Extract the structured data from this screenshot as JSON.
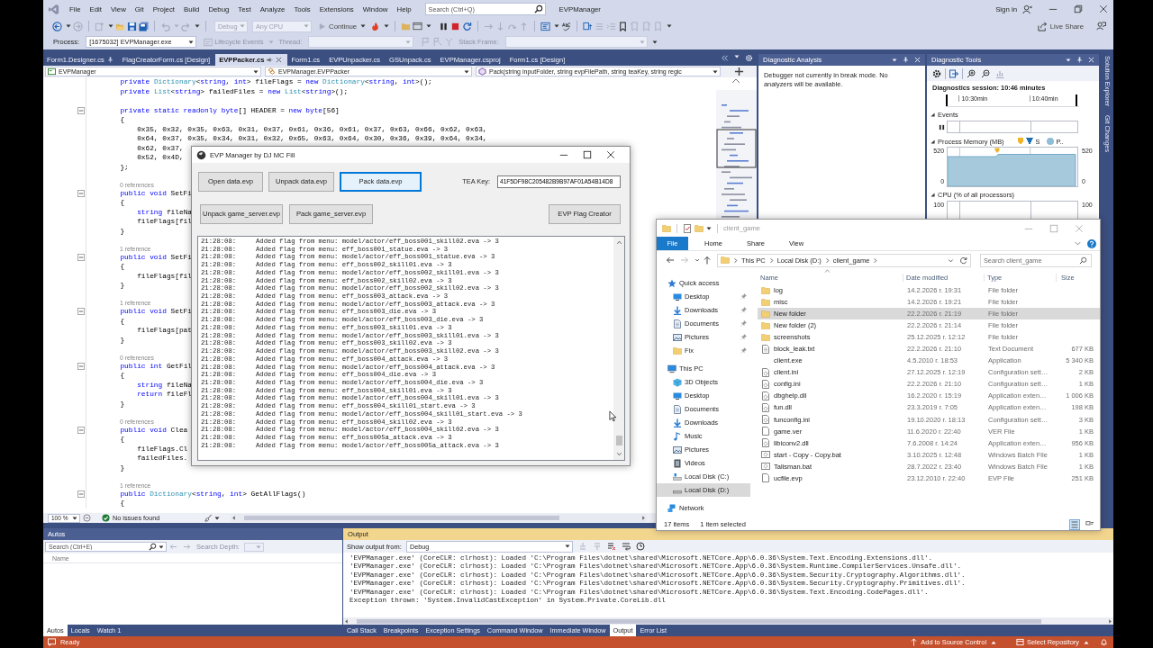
{
  "window": {
    "menu": [
      "File",
      "Edit",
      "View",
      "Git",
      "Project",
      "Build",
      "Debug",
      "Test",
      "Analyze",
      "Tools",
      "Extensions",
      "Window",
      "Help"
    ],
    "search": {
      "placeholder": "Search (Ctrl+Q)"
    },
    "title": "EVPManager",
    "sign_in": "Sign in"
  },
  "toolbar": {
    "configuration": {
      "value": "Debug",
      "disabled": true
    },
    "platform": {
      "value": "Any CPU",
      "disabled": true
    },
    "continue": "Continue",
    "live_share": "Live Share"
  },
  "debug_location": {
    "process_label": "Process:",
    "process": "[1675032] EVPManager.exe",
    "lifecycle_events": "Lifecycle Events",
    "thread_label": "Thread:",
    "stack_frame_label": "Stack Frame:"
  },
  "document_tabs": [
    {
      "label": "Form1.Designer.cs",
      "selected": false,
      "pinned": true
    },
    {
      "label": "FlagCreatorForm.cs [Design]",
      "selected": false,
      "pinned": false
    },
    {
      "label": "EVPPacker.cs",
      "selected": true,
      "pinned": false
    },
    {
      "label": "Form1.cs",
      "selected": false,
      "pinned": false
    },
    {
      "label": "EVPUnpacker.cs",
      "selected": false,
      "pinned": false
    },
    {
      "label": "GSUnpack.cs",
      "selected": false,
      "pinned": false
    },
    {
      "label": "EVPManager.csproj",
      "selected": false,
      "pinned": false
    },
    {
      "label": "Form1.cs [Design]",
      "selected": false,
      "pinned": false
    }
  ],
  "navigation_bar": {
    "project": "EVPManager",
    "type": "EVPManager.EVPPacker",
    "member": "Pack(string inputFolder, string evpFilePath, string teaKey, string regic"
  },
  "editor": {
    "lines": [
      {
        "kind": "code",
        "segments": [
          {
            "kind": "keyword",
            "text": "        private "
          },
          {
            "kind": "type",
            "text": "Dictionary"
          },
          {
            "kind": "plain",
            "text": "<"
          },
          {
            "kind": "keyword",
            "text": "string"
          },
          {
            "kind": "plain",
            "text": ", "
          },
          {
            "kind": "keyword",
            "text": "int"
          },
          {
            "kind": "plain",
            "text": "> fileFlags = "
          },
          {
            "kind": "keyword",
            "text": "new "
          },
          {
            "kind": "type",
            "text": "Dictionary"
          },
          {
            "kind": "plain",
            "text": "<"
          },
          {
            "kind": "keyword",
            "text": "string"
          },
          {
            "kind": "plain",
            "text": ", "
          },
          {
            "kind": "keyword",
            "text": "int"
          },
          {
            "kind": "plain",
            "text": ">();"
          }
        ]
      },
      {
        "kind": "code",
        "segments": [
          {
            "kind": "keyword",
            "text": "        private "
          },
          {
            "kind": "type",
            "text": "List"
          },
          {
            "kind": "plain",
            "text": "<"
          },
          {
            "kind": "keyword",
            "text": "string"
          },
          {
            "kind": "plain",
            "text": "> failedFiles = "
          },
          {
            "kind": "keyword",
            "text": "new "
          },
          {
            "kind": "type",
            "text": "List"
          },
          {
            "kind": "plain",
            "text": "<"
          },
          {
            "kind": "keyword",
            "text": "string"
          },
          {
            "kind": "plain",
            "text": ">();"
          }
        ]
      },
      {
        "kind": "blank"
      },
      {
        "kind": "member",
        "segments": [
          {
            "kind": "keyword",
            "text": "        private static readonly byte"
          },
          {
            "kind": "plain",
            "text": "[] HEADER = "
          },
          {
            "kind": "keyword",
            "text": "new byte"
          },
          {
            "kind": "plain",
            "text": "[56]"
          }
        ]
      },
      {
        "kind": "code",
        "segments": [
          {
            "kind": "plain",
            "text": "        {"
          }
        ]
      },
      {
        "kind": "code",
        "segments": [
          {
            "kind": "plain",
            "text": "            0x35, 0x32, 0x35, 0x63, 0x31, 0x37, 0x61, 0x36, 0x61, 0x37, 0x63, 0x66, 0x62, 0x63,"
          }
        ]
      },
      {
        "kind": "code",
        "segments": [
          {
            "kind": "plain",
            "text": "            0x64, 0x37, 0x35, 0x34, 0x31, 0x32, 0x65, 0x63, 0x64, 0x30, 0x36, 0x39, 0x64, 0x34,"
          }
        ]
      },
      {
        "kind": "code",
        "segments": [
          {
            "kind": "plain",
            "text": "            0x62, 0x37,"
          }
        ]
      },
      {
        "kind": "code",
        "segments": [
          {
            "kind": "plain",
            "text": "            0x52, 0x4D,"
          }
        ]
      },
      {
        "kind": "code",
        "segments": [
          {
            "kind": "plain",
            "text": "        };"
          }
        ]
      },
      {
        "kind": "blank"
      },
      {
        "kind": "lens",
        "text": "0 references"
      },
      {
        "kind": "member",
        "segments": [
          {
            "kind": "keyword",
            "text": "        public void"
          },
          {
            "kind": "plain",
            "text": " SetFi"
          }
        ]
      },
      {
        "kind": "code",
        "segments": [
          {
            "kind": "plain",
            "text": "        {"
          }
        ]
      },
      {
        "kind": "code",
        "segments": [
          {
            "kind": "keyword",
            "text": "            string"
          },
          {
            "kind": "plain",
            "text": " fileNa"
          }
        ]
      },
      {
        "kind": "code",
        "segments": [
          {
            "kind": "plain",
            "text": "            fileFlags[fil"
          }
        ]
      },
      {
        "kind": "code",
        "segments": [
          {
            "kind": "plain",
            "text": "        }"
          }
        ]
      },
      {
        "kind": "blank"
      },
      {
        "kind": "lens",
        "text": "1 reference"
      },
      {
        "kind": "member",
        "segments": [
          {
            "kind": "keyword",
            "text": "        public void"
          },
          {
            "kind": "plain",
            "text": " SetFi"
          }
        ]
      },
      {
        "kind": "code",
        "segments": [
          {
            "kind": "plain",
            "text": "        {"
          }
        ]
      },
      {
        "kind": "code",
        "segments": [
          {
            "kind": "plain",
            "text": "            fileFlags[fil"
          }
        ]
      },
      {
        "kind": "code",
        "segments": [
          {
            "kind": "plain",
            "text": "        }"
          }
        ]
      },
      {
        "kind": "blank"
      },
      {
        "kind": "lens",
        "text": "1 reference"
      },
      {
        "kind": "member",
        "segments": [
          {
            "kind": "keyword",
            "text": "        public void"
          },
          {
            "kind": "plain",
            "text": " SetFi"
          }
        ]
      },
      {
        "kind": "code",
        "segments": [
          {
            "kind": "plain",
            "text": "        {"
          }
        ]
      },
      {
        "kind": "code",
        "segments": [
          {
            "kind": "plain",
            "text": "            fileFlags[pat"
          }
        ]
      },
      {
        "kind": "code",
        "segments": [
          {
            "kind": "plain",
            "text": "        }"
          }
        ]
      },
      {
        "kind": "blank"
      },
      {
        "kind": "lens",
        "text": "0 references"
      },
      {
        "kind": "member",
        "segments": [
          {
            "kind": "keyword",
            "text": "        public int"
          },
          {
            "kind": "plain",
            "text": " GetFil"
          }
        ]
      },
      {
        "kind": "code",
        "segments": [
          {
            "kind": "plain",
            "text": "        {"
          }
        ]
      },
      {
        "kind": "code",
        "segments": [
          {
            "kind": "keyword",
            "text": "            string"
          },
          {
            "kind": "plain",
            "text": " fileNa"
          }
        ]
      },
      {
        "kind": "code",
        "segments": [
          {
            "kind": "keyword",
            "text": "            return"
          },
          {
            "kind": "plain",
            "text": " fileFl"
          }
        ]
      },
      {
        "kind": "code",
        "segments": [
          {
            "kind": "plain",
            "text": "        }"
          }
        ]
      },
      {
        "kind": "blank"
      },
      {
        "kind": "lens",
        "text": "0 references"
      },
      {
        "kind": "member",
        "segments": [
          {
            "kind": "keyword",
            "text": "        public void"
          },
          {
            "kind": "plain",
            "text": " Clea"
          }
        ]
      },
      {
        "kind": "code",
        "segments": [
          {
            "kind": "plain",
            "text": "        {"
          }
        ]
      },
      {
        "kind": "code",
        "segments": [
          {
            "kind": "plain",
            "text": "            fileFlags.Cl"
          }
        ]
      },
      {
        "kind": "code",
        "segments": [
          {
            "kind": "plain",
            "text": "            failedFiles."
          }
        ]
      },
      {
        "kind": "code",
        "segments": [
          {
            "kind": "plain",
            "text": "        }"
          }
        ]
      },
      {
        "kind": "blank"
      },
      {
        "kind": "lens",
        "text": "1 reference"
      },
      {
        "kind": "member",
        "segments": [
          {
            "kind": "keyword",
            "text": "        public "
          },
          {
            "kind": "type",
            "text": "Dictionary"
          },
          {
            "kind": "plain",
            "text": "<"
          },
          {
            "kind": "keyword",
            "text": "string"
          },
          {
            "kind": "plain",
            "text": ", "
          },
          {
            "kind": "keyword",
            "text": "int"
          },
          {
            "kind": "plain",
            "text": "> GetAllFlags()"
          }
        ]
      },
      {
        "kind": "code",
        "segments": [
          {
            "kind": "plain",
            "text": "        {"
          }
        ]
      }
    ],
    "zoom": "100 %",
    "issues": "No issues found"
  },
  "evp_manager": {
    "title": "EVP Manager by DJ MC Fill",
    "buttons_row_1": [
      {
        "label": "Open data.evp",
        "focused": false
      },
      {
        "label": "Unpack data.evp",
        "focused": false
      },
      {
        "label": "Pack data.evp",
        "focused": true
      }
    ],
    "tea_key": {
      "label": "TEA Key:",
      "value": "41F5DF98C205482B9B97AF01A54B14D8"
    },
    "buttons_row_2": [
      "Unpack game_server.evp",
      "Pack game_server.evp"
    ],
    "flag_creator": "EVP Flag Creator",
    "log": [
      {
        "time": "21:28:08:",
        "message": "Added flag from menu: model/actor/eff_boss001_skill02.eva -> 3"
      },
      {
        "time": "21:28:08:",
        "message": "Added flag from menu: eff_boss001_statue.eva -> 3"
      },
      {
        "time": "21:28:08:",
        "message": "Added flag from menu: model/actor/eff_boss001_statue.eva -> 3"
      },
      {
        "time": "21:28:08:",
        "message": "Added flag from menu: eff_boss002_skill01.eva -> 3"
      },
      {
        "time": "21:28:08:",
        "message": "Added flag from menu: model/actor/eff_boss002_skill01.eva -> 3"
      },
      {
        "time": "21:28:08:",
        "message": "Added flag from menu: eff_boss002_skill02.eva -> 3"
      },
      {
        "time": "21:28:08:",
        "message": "Added flag from menu: model/actor/eff_boss002_skill02.eva -> 3"
      },
      {
        "time": "21:28:08:",
        "message": "Added flag from menu: eff_boss003_attack.eva -> 3"
      },
      {
        "time": "21:28:08:",
        "message": "Added flag from menu: model/actor/eff_boss003_attack.eva -> 3"
      },
      {
        "time": "21:28:08:",
        "message": "Added flag from menu: eff_boss003_die.eva -> 3"
      },
      {
        "time": "21:28:08:",
        "message": "Added flag from menu: model/actor/eff_boss003_die.eva -> 3"
      },
      {
        "time": "21:28:08:",
        "message": "Added flag from menu: eff_boss003_skill01.eva -> 3"
      },
      {
        "time": "21:28:08:",
        "message": "Added flag from menu: model/actor/eff_boss003_skill01.eva -> 3"
      },
      {
        "time": "21:28:08:",
        "message": "Added flag from menu: eff_boss003_skill02.eva -> 3"
      },
      {
        "time": "21:28:08:",
        "message": "Added flag from menu: model/actor/eff_boss003_skill02.eva -> 3"
      },
      {
        "time": "21:28:08:",
        "message": "Added flag from menu: eff_boss004_attack.eva -> 3"
      },
      {
        "time": "21:28:08:",
        "message": "Added flag from menu: model/actor/eff_boss004_attack.eva -> 3"
      },
      {
        "time": "21:28:08:",
        "message": "Added flag from menu: eff_boss004_die.eva -> 3"
      },
      {
        "time": "21:28:08:",
        "message": "Added flag from menu: model/actor/eff_boss004_die.eva -> 3"
      },
      {
        "time": "21:28:08:",
        "message": "Added flag from menu: eff_boss004_skill01.eva -> 3"
      },
      {
        "time": "21:28:08:",
        "message": "Added flag from menu: model/actor/eff_boss004_skill01.eva -> 3"
      },
      {
        "time": "21:28:08:",
        "message": "Added flag from menu: eff_boss004_skill01_start.eva -> 3"
      },
      {
        "time": "21:28:08:",
        "message": "Added flag from menu: model/actor/eff_boss004_skill01_start.eva -> 3"
      },
      {
        "time": "21:28:08:",
        "message": "Added flag from menu: eff_boss004_skill02.eva -> 3"
      },
      {
        "time": "21:28:08:",
        "message": "Added flag from menu: model/actor/eff_boss004_skill02.eva -> 3"
      },
      {
        "time": "21:28:08:",
        "message": "Added flag from menu: eff_boss005a_attack.eva -> 3"
      },
      {
        "time": "21:28:08:",
        "message": "Added flag from menu: model/actor/eff_boss005a_attack.eva -> 3"
      }
    ]
  },
  "diagnostic_analysis": {
    "title": "Diagnostic Analysis",
    "message": "Debugger not currently in break mode. No analyzers will be available."
  },
  "diagnostic_tools": {
    "title": "Diagnostic Tools",
    "session": "Diagnostics session: 10:46 minutes",
    "ruler": [
      "10:30min",
      "10:40min"
    ],
    "events": {
      "title": "Events"
    },
    "memory": {
      "title": "Process Memory (MB)",
      "legend": [
        {
          "kind": "marker",
          "color": "#f0b429"
        },
        {
          "kind": "triangle",
          "label": "S",
          "color": "#1c6fb5"
        },
        {
          "kind": "circle",
          "label": "P..",
          "color": "#8fbcd6"
        }
      ],
      "left_labels": [
        "520",
        "0"
      ],
      "right_labels": [
        "520",
        "0"
      ]
    },
    "cpu": {
      "title": "CPU (% of all processors)",
      "left_label": "100",
      "right_label": "100"
    }
  },
  "side_tabs": [
    "Solution Explorer",
    "Git Changes"
  ],
  "explorer": {
    "title": "client_game",
    "ribbon": {
      "file_button": "File",
      "tabs": [
        "Home",
        "Share",
        "View"
      ]
    },
    "path": [
      "This PC",
      "Local Disk (D:)",
      "client_game"
    ],
    "search": {
      "placeholder": "Search client_game"
    },
    "nav": [
      {
        "label": "Quick access",
        "kind": "star",
        "pinned": false,
        "selected": false,
        "children": [
          {
            "label": "Desktop",
            "kind": "desktop",
            "pinned": true,
            "selected": false
          },
          {
            "label": "Downloads",
            "kind": "download",
            "pinned": true,
            "selected": false
          },
          {
            "label": "Documents",
            "kind": "document",
            "pinned": true,
            "selected": false
          },
          {
            "label": "Pictures",
            "kind": "picture",
            "pinned": true,
            "selected": false
          },
          {
            "label": "Fix",
            "kind": "folder",
            "pinned": true,
            "selected": false
          }
        ]
      },
      {
        "label": "This PC",
        "kind": "computer",
        "pinned": false,
        "selected": false,
        "children": [
          {
            "label": "3D Objects",
            "kind": "cube",
            "pinned": false,
            "selected": false
          },
          {
            "label": "Desktop",
            "kind": "desktop",
            "pinned": false,
            "selected": false
          },
          {
            "label": "Documents",
            "kind": "document",
            "pinned": false,
            "selected": false
          },
          {
            "label": "Downloads",
            "kind": "download",
            "pinned": false,
            "selected": false
          },
          {
            "label": "Music",
            "kind": "music",
            "pinned": false,
            "selected": false
          },
          {
            "label": "Pictures",
            "kind": "picture",
            "pinned": false,
            "selected": false
          },
          {
            "label": "Videos",
            "kind": "video",
            "pinned": false,
            "selected": false
          },
          {
            "label": "Local Disk (C:)",
            "kind": "system_drive",
            "pinned": false,
            "selected": false
          },
          {
            "label": "Local Disk (D:)",
            "kind": "drive",
            "pinned": false,
            "selected": true
          }
        ]
      },
      {
        "label": "Network",
        "kind": "network",
        "pinned": false,
        "selected": false
      }
    ],
    "columns": [
      "Name",
      "Date modified",
      "Type",
      "Size"
    ],
    "files": [
      {
        "name": "log",
        "kind": "folder",
        "date": "14.2.2026 г. 19:31",
        "type": "File folder",
        "selected": false
      },
      {
        "name": "misc",
        "kind": "folder",
        "date": "14.2.2026 г. 19:21",
        "type": "File folder",
        "selected": false
      },
      {
        "name": "New folder",
        "kind": "folder",
        "date": "22.2.2026 г. 21:19",
        "type": "File folder",
        "selected": true
      },
      {
        "name": "New folder (2)",
        "kind": "folder",
        "date": "22.2.2026 г. 21:14",
        "type": "File folder",
        "selected": false
      },
      {
        "name": "screenshots",
        "kind": "folder",
        "date": "25.12.2025 г. 12:12",
        "type": "File folder",
        "selected": false
      },
      {
        "name": "block_leak.txt",
        "kind": "text",
        "date": "22.2.2026 г. 21:10",
        "type": "Text Document",
        "size": "677 KB",
        "selected": false
      },
      {
        "name": "client.exe",
        "kind": "application",
        "date": "4.5.2010 г. 18:53",
        "type": "Application",
        "size": "5 340 KB",
        "selected": false
      },
      {
        "name": "client.ini",
        "kind": "settings",
        "date": "27.12.2025 г. 12:19",
        "type": "Configuration sett…",
        "size": "2 KB",
        "selected": false
      },
      {
        "name": "config.ini",
        "kind": "settings",
        "date": "22.2.2026 г. 21:10",
        "type": "Configuration sett…",
        "size": "1 KB",
        "selected": false
      },
      {
        "name": "dbghelp.dll",
        "kind": "settings",
        "date": "16.2.2020 г. 15:19",
        "type": "Application exten…",
        "size": "1 006 KB",
        "selected": false
      },
      {
        "name": "fun.dll",
        "kind": "settings",
        "date": "23.3.2019 г. 7:05",
        "type": "Application exten…",
        "size": "198 KB",
        "selected": false
      },
      {
        "name": "funconfig.ini",
        "kind": "settings",
        "date": "19.10.2020 г. 18:13",
        "type": "Configuration sett…",
        "size": "3 KB",
        "selected": false
      },
      {
        "name": "game.ver",
        "kind": "plain",
        "date": "11.6.2020 г. 22:40",
        "type": "VER File",
        "size": "1 KB",
        "selected": false
      },
      {
        "name": "libiconv2.dll",
        "kind": "settings",
        "date": "7.6.2008 г. 14:24",
        "type": "Application exten…",
        "size": "956 KB",
        "selected": false
      },
      {
        "name": "start - Copy - Copy.bat",
        "kind": "batch",
        "date": "3.10.2025 г. 12:48",
        "type": "Windows Batch File",
        "size": "1 KB",
        "selected": false
      },
      {
        "name": "Talisman.bat",
        "kind": "batch",
        "date": "28.7.2022 г. 23:40",
        "type": "Windows Batch File",
        "size": "1 KB",
        "selected": false
      },
      {
        "name": "ucfile.evp",
        "kind": "plain",
        "date": "23.12.2010 г. 22:40",
        "type": "EVP File",
        "size": "251 KB",
        "selected": false
      }
    ],
    "status": {
      "count": "17 items",
      "selection": "1 item selected"
    }
  },
  "autos": {
    "title": "Autos",
    "search": {
      "placeholder": "Search (Ctrl+E)"
    },
    "depth_label": "Search Depth:",
    "columns": [
      "Name"
    ],
    "tabs": [
      {
        "label": "Autos",
        "selected": true
      },
      {
        "label": "Locals",
        "selected": false
      },
      {
        "label": "Watch 1",
        "selected": false
      }
    ]
  },
  "output": {
    "title": "Output",
    "source_label": "Show output from:",
    "source": "Debug",
    "lines": [
      "'EVPManager.exe' (CoreCLR: clrhost): Loaded 'C:\\Program Files\\dotnet\\shared\\Microsoft.NETCore.App\\6.0.36\\System.Text.Encoding.Extensions.dll'.",
      "'EVPManager.exe' (CoreCLR: clrhost): Loaded 'C:\\Program Files\\dotnet\\shared\\Microsoft.NETCore.App\\6.0.36\\System.Runtime.CompilerServices.Unsafe.dll'.",
      "'EVPManager.exe' (CoreCLR: clrhost): Loaded 'C:\\Program Files\\dotnet\\shared\\Microsoft.NETCore.App\\6.0.36\\System.Security.Cryptography.Algorithms.dll'.",
      "'EVPManager.exe' (CoreCLR: clrhost): Loaded 'C:\\Program Files\\dotnet\\shared\\Microsoft.NETCore.App\\6.0.36\\System.Security.Cryptography.Primitives.dll'.",
      "'EVPManager.exe' (CoreCLR: clrhost): Loaded 'C:\\Program Files\\dotnet\\shared\\Microsoft.NETCore.App\\6.0.36\\System.Text.Encoding.CodePages.dll'.",
      "Exception thrown: 'System.InvalidCastException' in System.Private.CoreLib.dll"
    ],
    "tabs": [
      {
        "label": "Call Stack",
        "selected": false
      },
      {
        "label": "Breakpoints",
        "selected": false
      },
      {
        "label": "Exception Settings",
        "selected": false
      },
      {
        "label": "Command Window",
        "selected": false
      },
      {
        "label": "Immediate Window",
        "selected": false
      },
      {
        "label": "Output",
        "selected": true
      },
      {
        "label": "Error List",
        "selected": false
      }
    ]
  },
  "status_bar": {
    "text": "Ready",
    "source_control": "Add to Source Control",
    "repository": "Select Repository"
  }
}
